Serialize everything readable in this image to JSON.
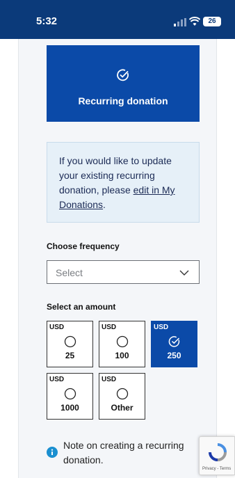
{
  "status_bar": {
    "time": "5:32",
    "battery": "26",
    "icons": [
      "signal-icon",
      "wifi-icon",
      "battery-icon"
    ]
  },
  "recurring_card": {
    "label": "Recurring donation",
    "icon": "check-circle-icon"
  },
  "info_box": {
    "text_before": "If you would like to update your existing recurring donation, please ",
    "link_text": "edit in My Donations",
    "text_after": "."
  },
  "frequency": {
    "label": "Choose frequency",
    "placeholder": "Select"
  },
  "amount": {
    "label": "Select an amount",
    "tiles": [
      {
        "currency": "USD",
        "value": "25",
        "selected": false
      },
      {
        "currency": "USD",
        "value": "100",
        "selected": false
      },
      {
        "currency": "USD",
        "value": "250",
        "selected": true
      },
      {
        "currency": "USD",
        "value": "1000",
        "selected": false
      },
      {
        "currency": "USD",
        "value": "Other",
        "selected": false
      }
    ]
  },
  "note": {
    "text": "Note on creating a recurring donation."
  },
  "recaptcha": {
    "footer": "Privacy - Terms"
  },
  "colors": {
    "header": "#0b3a7a",
    "primary": "#0b4aa8",
    "info_bg": "#e6f0f8",
    "info_icon": "#1a8fd0"
  }
}
